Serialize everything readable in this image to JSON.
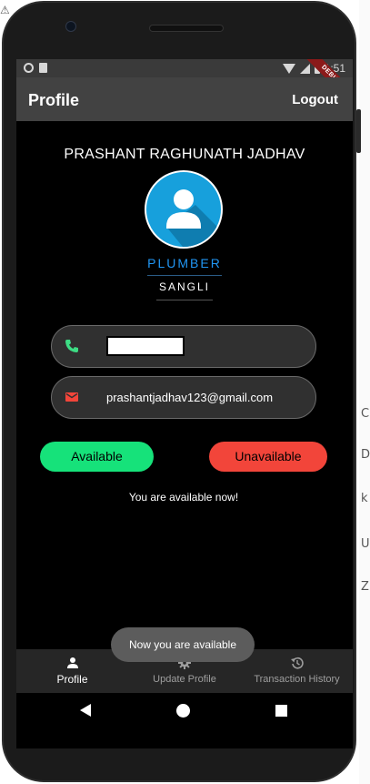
{
  "app": {
    "title": "Profile",
    "logout_label": "Logout",
    "debug_banner": "DEBUG"
  },
  "status_bar": {
    "time": "1:51"
  },
  "profile": {
    "name": "PRASHANT RAGHUNATH JADHAV",
    "role": "PLUMBER",
    "city": "SANGLI",
    "phone": "",
    "email": "prashantjadhav123@gmail.com"
  },
  "availability": {
    "available_label": "Available",
    "unavailable_label": "Unavailable",
    "status_message": "You are available now!"
  },
  "toast": "Now you are available",
  "bottom_nav": {
    "items": [
      {
        "label": "Profile",
        "icon": "person-icon",
        "active": true
      },
      {
        "label": "Update Profile",
        "icon": "gear-icon",
        "active": false
      },
      {
        "label": "Transaction History",
        "icon": "history-icon",
        "active": false
      }
    ]
  },
  "colors": {
    "accent_blue": "#2196f3",
    "available_green": "#16e27a",
    "unavailable_red": "#f2453a",
    "phone_icon_green": "#3ddc84",
    "email_icon_red": "#f2453a",
    "avatar_blue": "#17a0dc"
  },
  "side_strip": {
    "corner": "⚠",
    "chars": [
      "C",
      "D",
      "k",
      "U",
      "Z"
    ]
  }
}
